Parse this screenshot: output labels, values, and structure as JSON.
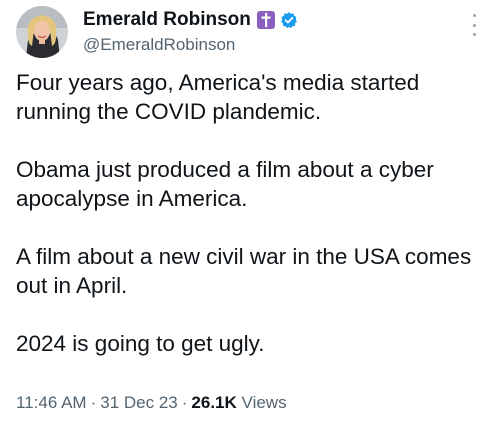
{
  "author": {
    "display_name": "Emerald Robinson",
    "handle": "@EmeraldRobinson"
  },
  "badges": {
    "emoji_icon": "latin-cross-icon",
    "verified_icon": "verified-badge-icon",
    "verified_color": "#1d9bf0",
    "cross_badge_color": "#8b5fbf"
  },
  "menu_icon": "more-options-icon",
  "tweet": {
    "paragraphs": [
      "Four years ago, America's media started running the COVID plandemic.",
      "Obama just produced a film about a cyber apocalypse in America.",
      "A film about a new civil war in the USA comes out in April.",
      "2024 is going to get ugly."
    ]
  },
  "meta": {
    "time": "11:46 AM",
    "separator": "·",
    "date": "31 Dec 23",
    "views_count": "26.1K",
    "views_label": "Views"
  }
}
